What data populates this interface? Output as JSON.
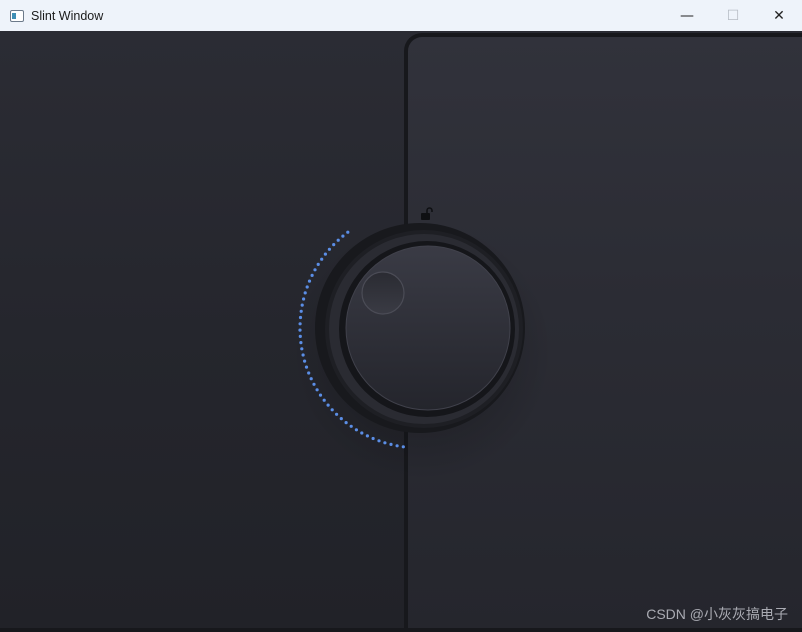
{
  "window": {
    "title": "Slint Window",
    "controls": {
      "minimize": "—",
      "maximize": "☐",
      "close": "✕"
    }
  },
  "knob": {
    "locked": false,
    "level_dots": 46,
    "accent_color": "#5b8ee6"
  },
  "icons": {
    "app": "window-icon",
    "lock": "unlocked-padlock-icon"
  },
  "watermark": {
    "text": "CSDN @小灰灰搞电子"
  }
}
